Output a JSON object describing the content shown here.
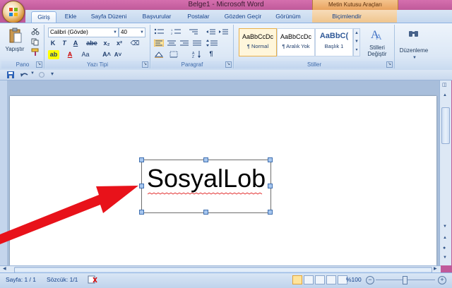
{
  "window": {
    "title": "Belge1 - Microsoft Word",
    "context_tab_header": "Metin Kutusu Araçları"
  },
  "tabs": [
    {
      "label": "Giriş",
      "active": true
    },
    {
      "label": "Ekle"
    },
    {
      "label": "Sayfa Düzeni"
    },
    {
      "label": "Başvurular"
    },
    {
      "label": "Postalar"
    },
    {
      "label": "Gözden Geçir"
    },
    {
      "label": "Görünüm"
    },
    {
      "label": "Biçimlendir"
    }
  ],
  "ribbon": {
    "clipboard": {
      "paste_label": "Yapıştır",
      "group_label": "Pano"
    },
    "font": {
      "font_name": "Calibri (Gövde)",
      "font_size": "40",
      "group_label": "Yazı Tipi",
      "bold": "K",
      "italic": "T",
      "underline": "A",
      "strike": "abe",
      "subscript": "x₂",
      "superscript": "x²",
      "change_case": "Aa",
      "grow": "A˄",
      "shrink": "A˅"
    },
    "paragraph": {
      "group_label": "Paragraf"
    },
    "styles": {
      "group_label": "Stiller",
      "items": [
        {
          "sample": "AaBbCcDc",
          "name": "¶ Normal",
          "active": true
        },
        {
          "sample": "AaBbCcDc",
          "name": "¶ Aralık Yok"
        },
        {
          "sample": "AaBbC(",
          "name": "Başlık 1"
        }
      ],
      "change_styles_label": "Stilleri Değiştir"
    },
    "editing": {
      "label": "Düzenleme"
    }
  },
  "document": {
    "textbox_text": "SosyalLob"
  },
  "statusbar": {
    "page": "Sayfa: 1 / 1",
    "words": "Sözcük: 1/1",
    "zoom": "%100"
  },
  "colors": {
    "arrow": "#e8121a",
    "frame": "#c05a9a",
    "context_tab": "#efc58d"
  }
}
